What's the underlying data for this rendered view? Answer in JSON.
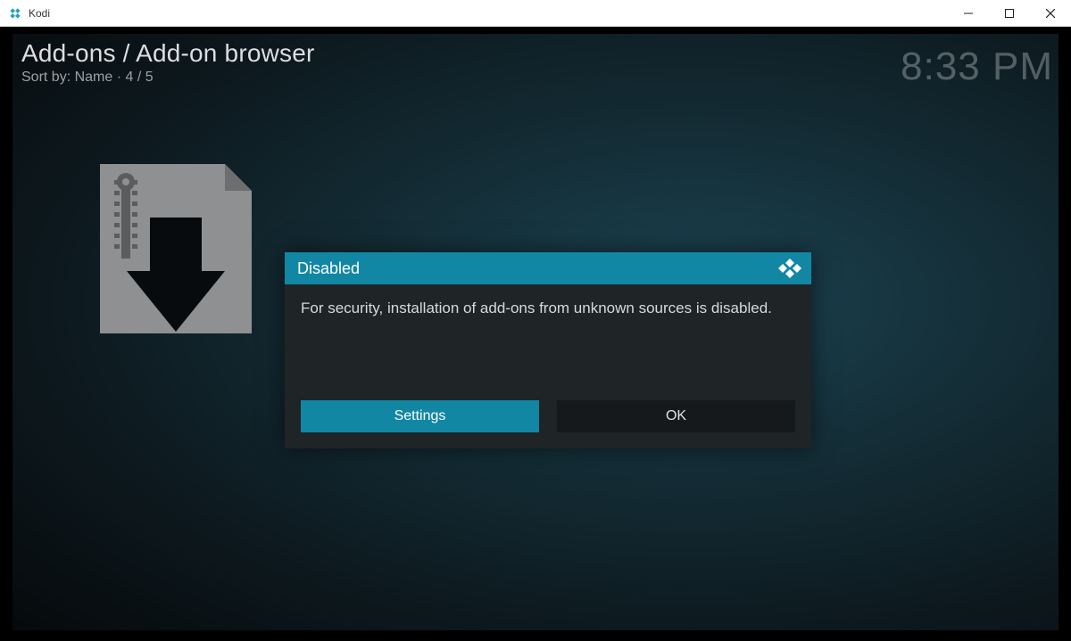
{
  "window": {
    "title": "Kodi"
  },
  "header": {
    "breadcrumb": "Add-ons / Add-on browser",
    "sort_line": "Sort by: Name  ·  4 / 5",
    "clock": "8:33 PM"
  },
  "dialog": {
    "title": "Disabled",
    "message": "For security, installation of add-ons from unknown sources is disabled.",
    "settings_label": "Settings",
    "ok_label": "OK"
  },
  "icons": {
    "zip_install": "zip-install-icon",
    "kodi_logo": "kodi-logo-icon"
  }
}
